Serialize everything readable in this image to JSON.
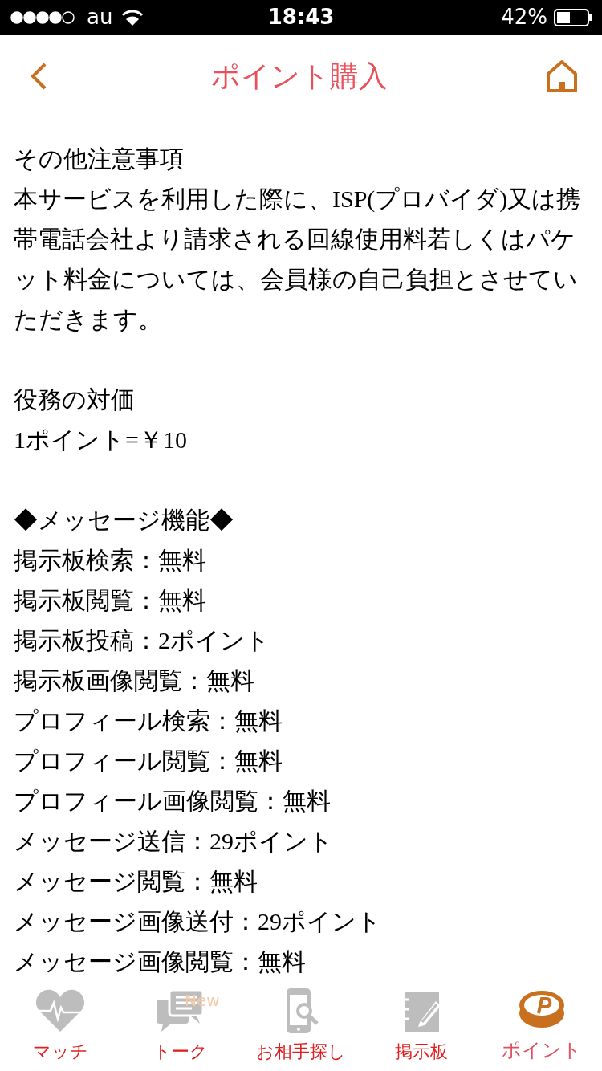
{
  "status_bar": {
    "carrier": "au",
    "time": "18:43",
    "battery": "42%"
  },
  "header": {
    "title": "ポイント購入"
  },
  "sections": [
    {
      "lines": [
        "その他注意事項",
        "本サービスを利用した際に、ISP(プロバイダ)又は携帯電話会社より請求される回線使用料若しくはパケット料金については、会員様の自己負担とさせていただきます。"
      ]
    },
    {
      "lines": [
        "役務の対価",
        "1ポイント=￥10"
      ]
    },
    {
      "lines": [
        "◆メッセージ機能◆",
        "掲示板検索：無料",
        "掲示板閲覧：無料",
        "掲示板投稿：2ポイント",
        "掲示板画像閲覧：無料",
        "プロフィール検索：無料",
        "プロフィール閲覧：無料",
        "プロフィール画像閲覧：無料",
        "メッセージ送信：29ポイント",
        "メッセージ閲覧：無料",
        "メッセージ画像送付：29ポイント",
        "メッセージ画像閲覧：無料"
      ]
    }
  ],
  "tab_bar": [
    {
      "kind": "heart",
      "label": "マッチ",
      "selected": false
    },
    {
      "kind": "talk",
      "label": "トーク",
      "badge": "New",
      "selected": false
    },
    {
      "kind": "search",
      "label": "お相手探し",
      "selected": false
    },
    {
      "kind": "board",
      "label": "掲示板",
      "selected": false
    },
    {
      "kind": "point",
      "label": "ポイント",
      "selected": true
    }
  ]
}
